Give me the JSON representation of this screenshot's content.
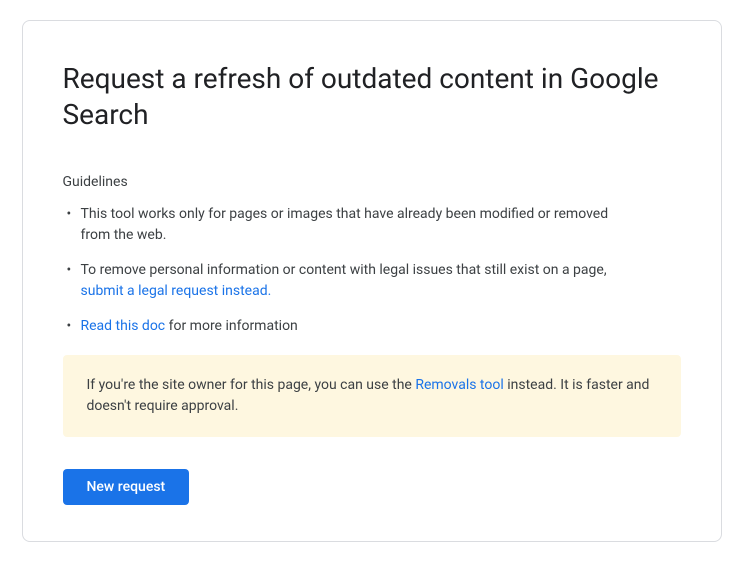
{
  "header": {
    "title": "Request a refresh of outdated content in Google Search"
  },
  "guidelines": {
    "label": "Guidelines",
    "items": [
      {
        "text": "This tool works only for pages or images that have already been modified or removed from the web."
      },
      {
        "prefix": "To remove personal information or content with legal issues that still exist on a page, ",
        "link_text": "submit a legal request instead."
      },
      {
        "link_text": "Read this doc",
        "suffix": " for more information"
      }
    ]
  },
  "info_box": {
    "prefix": "If you're the site owner for this page, you can use the ",
    "link_text": "Removals tool",
    "suffix": " instead. It is faster and doesn't require approval."
  },
  "actions": {
    "new_request_label": "New request"
  }
}
